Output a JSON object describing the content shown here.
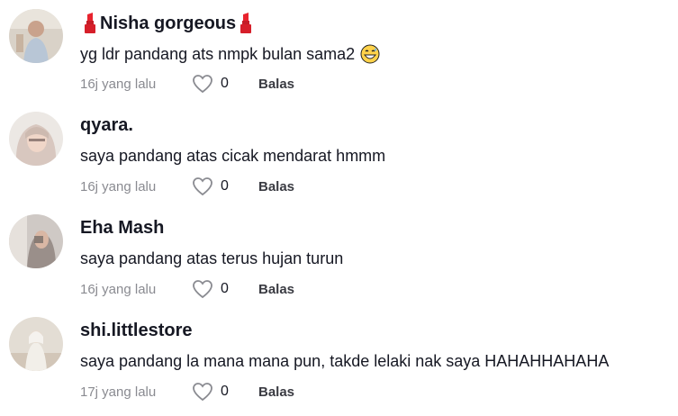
{
  "comments": [
    {
      "username": "Nisha gorgeous",
      "text": "yg ldr pandang ats nmpk bulan sama2",
      "emoji": "grinning-sweat-emoji",
      "time": "16j yang lalu",
      "likes": "0",
      "reply_label": "Balas",
      "decoration": "lipstick-icon"
    },
    {
      "username": "qyara.",
      "text": "saya pandang atas cicak mendarat hmmm",
      "time": "16j yang lalu",
      "likes": "0",
      "reply_label": "Balas"
    },
    {
      "username": "Eha Mash",
      "text": "saya pandang atas terus hujan turun",
      "time": "16j yang lalu",
      "likes": "0",
      "reply_label": "Balas"
    },
    {
      "username": "shi.littlestore",
      "text": "saya pandang la mana mana pun, takde lelaki nak saya HAHAHHAHAHA",
      "time": "17j yang lalu",
      "likes": "0",
      "reply_label": "Balas"
    }
  ],
  "colors": {
    "username": "#161823",
    "text": "#161823",
    "meta": "#8a8b91",
    "lipstick": "#e8232e"
  }
}
